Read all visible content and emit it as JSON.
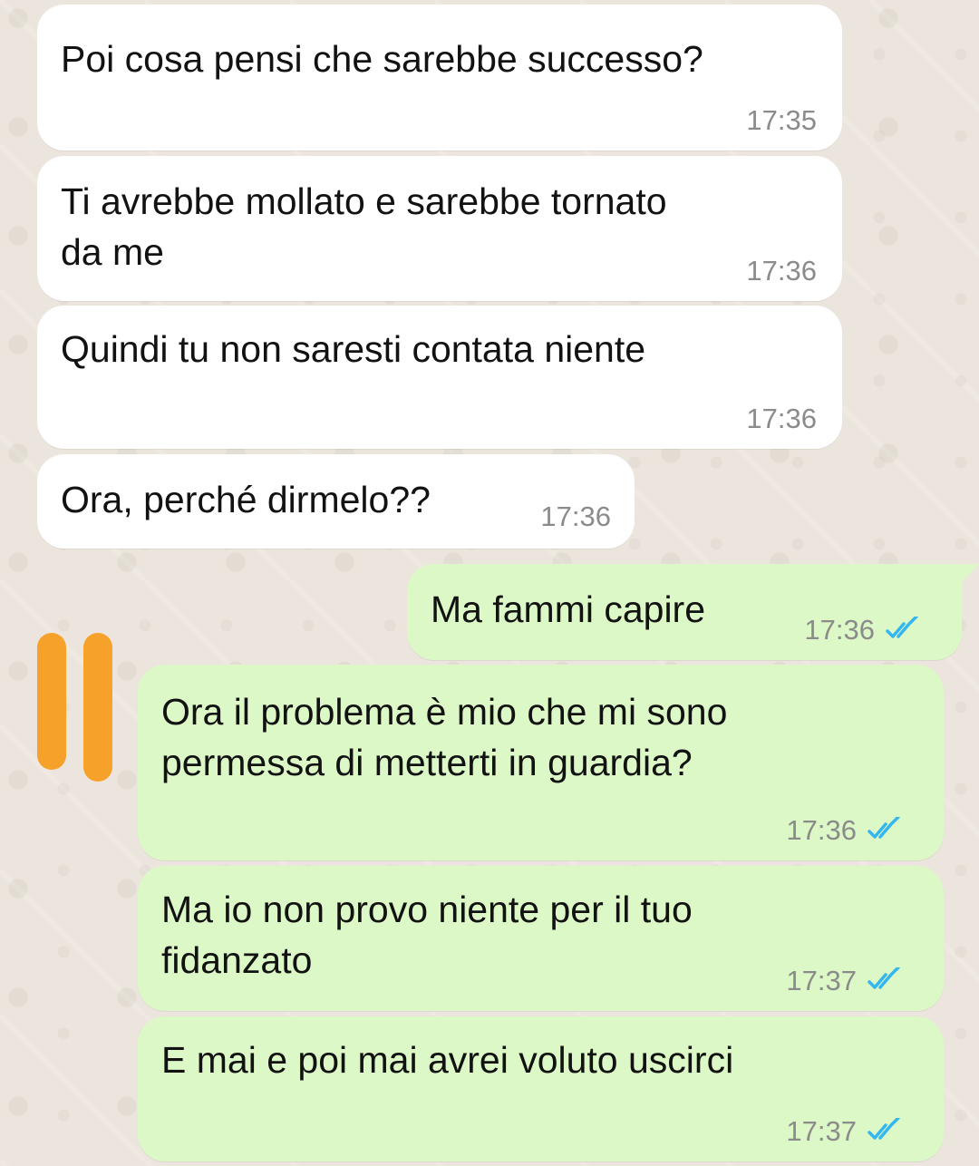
{
  "messages": [
    {
      "side": "incoming",
      "text": "Poi cosa pensi che sarebbe successo?",
      "time": "17:35"
    },
    {
      "side": "incoming",
      "text": "Ti avrebbe mollato e sarebbe tornato\nda me",
      "time": "17:36"
    },
    {
      "side": "incoming",
      "text": "Quindi tu non saresti contata niente",
      "time": "17:36"
    },
    {
      "side": "incoming",
      "text": "Ora, perché dirmelo??",
      "time": "17:36"
    },
    {
      "side": "outgoing",
      "text": "Ma fammi capire",
      "time": "17:36",
      "status": "read"
    },
    {
      "side": "outgoing",
      "text": "Ora il problema è mio che mi sono\npermessa di metterti in guardia?",
      "time": "17:36",
      "status": "read"
    },
    {
      "side": "outgoing",
      "text": "Ma io non provo niente per il tuo\nfidanzato",
      "time": "17:37",
      "status": "read"
    },
    {
      "side": "outgoing",
      "text": "E mai e poi mai avrei voluto uscirci",
      "time": "17:37",
      "status": "read"
    }
  ],
  "colors": {
    "incoming_bubble": "#ffffff",
    "outgoing_bubble": "#dcf8c6",
    "read_ticks": "#34b7f1",
    "highlight": "#f6a12a"
  },
  "icons": {
    "read_status": "double-check-icon"
  }
}
